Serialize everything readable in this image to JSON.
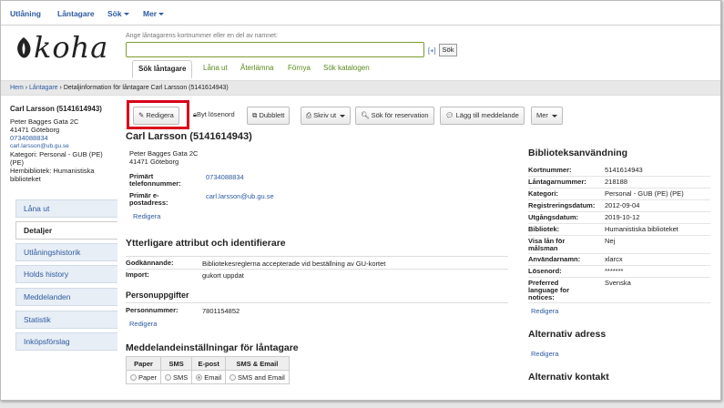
{
  "topnav": {
    "items": [
      "Utlåning",
      "Låntagare",
      "Sök",
      "Mer"
    ]
  },
  "logo": {
    "text": "koha"
  },
  "search": {
    "hint": "Ange låntagarens kortnummer eller en del av namnet:",
    "value": "",
    "plus": "[+]",
    "button": "Sök"
  },
  "tabs": [
    "Sök låntagare",
    "Låna ut",
    "Återlämna",
    "Förnya",
    "Sök katalogen"
  ],
  "breadcrumb": {
    "home": "Hem",
    "sep": "›",
    "patrons": "Låntagare",
    "current": "Detaljinformation för låntagare Carl Larsson (5141614943)"
  },
  "sidebar": {
    "name": "Carl Larsson (5141614943)",
    "street": "Peter Bagges Gata 2C",
    "city": "41471 Göteborg",
    "phone": "0734088834",
    "email": "carl.larsson@ub.gu.se",
    "category": "Kategori: Personal - GUB (PE)",
    "category2": "(PE)",
    "library": "Hembibliotek: Humanistiska",
    "library2": "biblioteket",
    "nav": [
      "Låna ut",
      "Detaljer",
      "Utlåningshistorik",
      "Holds history",
      "Meddelanden",
      "Statistik",
      "Inköpsförslag"
    ]
  },
  "toolbar": {
    "edit": "Redigera",
    "password": "Byt lösenord",
    "duplicate": "Dubblett",
    "print": "Skriv ut",
    "reserve": "Sök för reservation",
    "message": "Lägg till meddelande",
    "more": "Mer"
  },
  "patron": {
    "title": "Carl Larsson (5141614943)",
    "street": "Peter Bagges Gata 2C",
    "city": "41471 Göteborg",
    "phone_label": "Primärt telefonnummer:",
    "phone": "0734088834",
    "email_label": "Primär e-postadress:",
    "email": "carl.larsson@ub.gu.se",
    "edit": "Redigera"
  },
  "attributes": {
    "title": "Ytterligare attribut och identifierare",
    "rows": [
      {
        "label": "Godkännande:",
        "value": "Bibliotekesreglerna accepterade vid beställning av GU-kortet"
      },
      {
        "label": "Import:",
        "value": "gukort uppdat"
      }
    ]
  },
  "personal": {
    "title": "Personuppgifter",
    "label": "Personnummer:",
    "value": "7801154852",
    "edit": "Redigera"
  },
  "messaging": {
    "title": "Meddelandeinställningar för låntagare",
    "headers": [
      "Paper",
      "SMS",
      "E-post",
      "SMS & Email"
    ],
    "options": [
      "Paper",
      "SMS",
      "Email",
      "SMS and Email"
    ],
    "selected": "Email"
  },
  "library_use": {
    "title": "Biblioteksanvändning",
    "rows": [
      {
        "label": "Kortnummer:",
        "value": "5141614943"
      },
      {
        "label": "Låntagarnummer:",
        "value": "218188"
      },
      {
        "label": "Kategori:",
        "value": "Personal - GUB (PE) (PE)"
      },
      {
        "label": "Registreringsdatum:",
        "value": "2012-09-04"
      },
      {
        "label": "Utgångsdatum:",
        "value": "2019-10-12"
      },
      {
        "label": "Bibliotek:",
        "value": "Humanistiska biblioteket"
      },
      {
        "label": "Visa lån för målsman",
        "value": "Nej"
      },
      {
        "label": "Användarnamn:",
        "value": "xlarcx"
      },
      {
        "label": "Lösenord:",
        "value": "*******"
      },
      {
        "label": "Preferred language for notices:",
        "value": "Svenska"
      }
    ],
    "edit": "Redigera"
  },
  "alt_address": {
    "title": "Alternativ adress",
    "edit": "Redigera"
  },
  "alt_contact": {
    "title": "Alternativ kontakt"
  }
}
